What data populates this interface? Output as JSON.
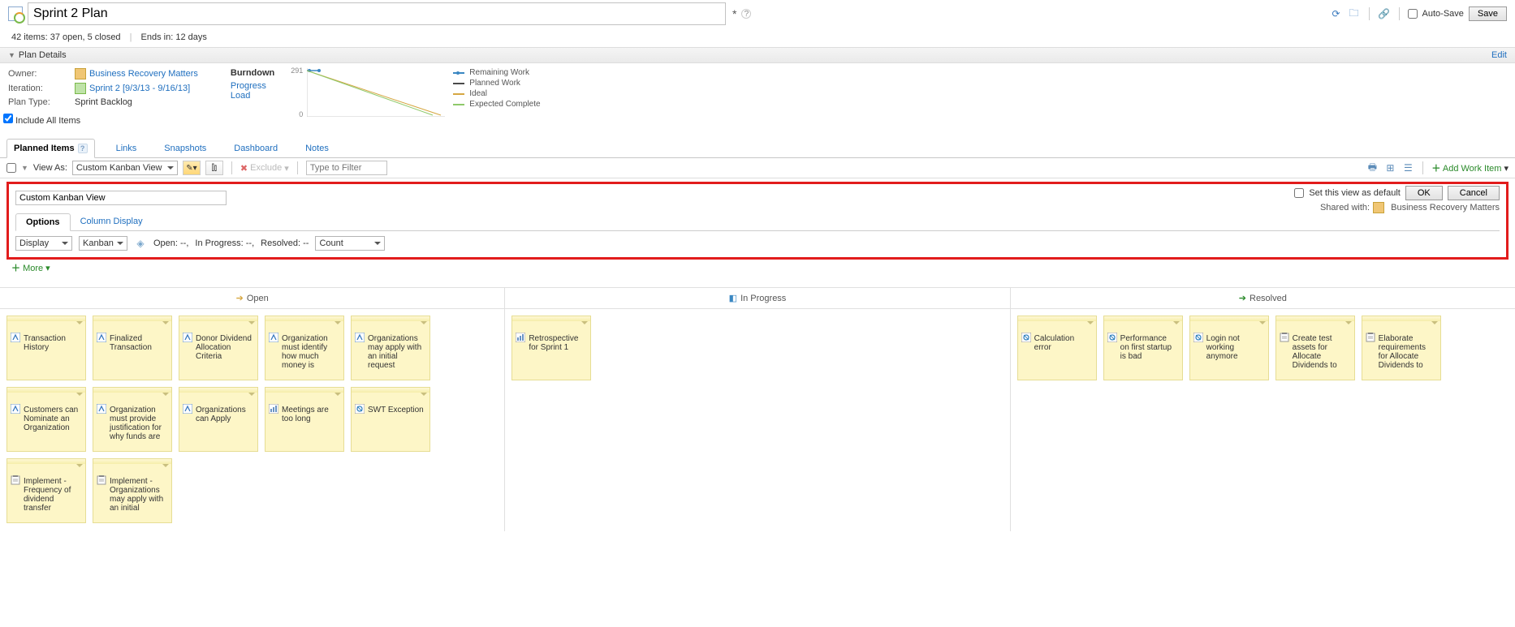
{
  "header": {
    "title": "Sprint 2 Plan",
    "dirty_marker": "*",
    "help": "?",
    "auto_save_label": "Auto-Save",
    "save_label": "Save"
  },
  "stats": {
    "items_count": "42 items:",
    "open_closed": "37 open, 5 closed",
    "ends_label": "Ends in:",
    "ends_value": "12 days"
  },
  "plan_details": {
    "header": "Plan Details",
    "edit": "Edit",
    "owner_label": "Owner:",
    "owner_value": "Business Recovery Matters",
    "iteration_label": "Iteration:",
    "iteration_value": "Sprint 2 [9/3/13 - 9/16/13]",
    "plan_type_label": "Plan Type:",
    "plan_type_value": "Sprint Backlog",
    "include_all": "Include All Items",
    "burndown_label": "Burndown",
    "progress_link": "Progress",
    "load_link": "Load",
    "y_top": "291",
    "y_bottom": "0",
    "legend": {
      "remaining": "Remaining Work",
      "planned": "Planned Work",
      "ideal": "Ideal",
      "expected": "Expected Complete"
    }
  },
  "chart_data": {
    "type": "line",
    "title": "Burndown",
    "ylim": [
      0,
      291
    ],
    "series": [
      {
        "name": "Remaining Work",
        "color": "#3a87c2"
      },
      {
        "name": "Planned Work",
        "color": "#4a4a4a"
      },
      {
        "name": "Ideal",
        "color": "#d6a742"
      },
      {
        "name": "Expected Complete",
        "color": "#8ec96a"
      }
    ]
  },
  "tabs": {
    "planned": "Planned Items",
    "links": "Links",
    "snapshots": "Snapshots",
    "dashboard": "Dashboard",
    "notes": "Notes"
  },
  "toolbar": {
    "view_as_label": "View As:",
    "view_as_value": "Custom Kanban View",
    "exclude_label": "Exclude",
    "filter_placeholder": "Type to Filter",
    "add_work_item": "Add Work Item"
  },
  "view_editor": {
    "name": "Custom Kanban View",
    "set_default": "Set this view as default",
    "ok": "OK",
    "cancel": "Cancel",
    "shared_label": "Shared with:",
    "shared_value": "Business Recovery Matters",
    "tab_options": "Options",
    "tab_column": "Column Display",
    "display_label": "Display",
    "kanban_label": "Kanban",
    "open_label": "Open: --,",
    "inprogress_label": "In Progress: --,",
    "resolved_label": "Resolved: --",
    "count_label": "Count",
    "more": "More"
  },
  "kanban": {
    "columns": {
      "open": "Open",
      "inprogress": "In Progress",
      "resolved": "Resolved"
    },
    "open_cards": [
      {
        "t": "Transaction History",
        "ico": "story"
      },
      {
        "t": "Finalized Transaction",
        "ico": "story"
      },
      {
        "t": "Donor Dividend Allocation Criteria",
        "ico": "story"
      },
      {
        "t": "Organization must identify how much money is",
        "ico": "story"
      },
      {
        "t": "Organizations may apply with an initial request",
        "ico": "story"
      },
      {
        "t": "Customers can Nominate an Organization",
        "ico": "story"
      },
      {
        "t": "Organization must provide justification for why funds are",
        "ico": "story"
      },
      {
        "t": "Organizations can Apply",
        "ico": "story"
      },
      {
        "t": "Meetings are too long",
        "ico": "retro"
      },
      {
        "t": "SWT Exception",
        "ico": "defect"
      },
      {
        "t": "Implement - Frequency of dividend transfer",
        "ico": "task"
      },
      {
        "t": "Implement - Organizations may apply with an initial",
        "ico": "task"
      }
    ],
    "inprogress_cards": [
      {
        "t": "Retrospective for Sprint 1",
        "ico": "retro"
      }
    ],
    "resolved_cards": [
      {
        "t": "Calculation error",
        "ico": "defect"
      },
      {
        "t": "Performance on first startup is bad",
        "ico": "defect"
      },
      {
        "t": "Login not working anymore",
        "ico": "defect"
      },
      {
        "t": "Create test assets for Allocate Dividends to",
        "ico": "task"
      },
      {
        "t": "Elaborate requirements for Allocate Dividends to",
        "ico": "task"
      }
    ]
  }
}
